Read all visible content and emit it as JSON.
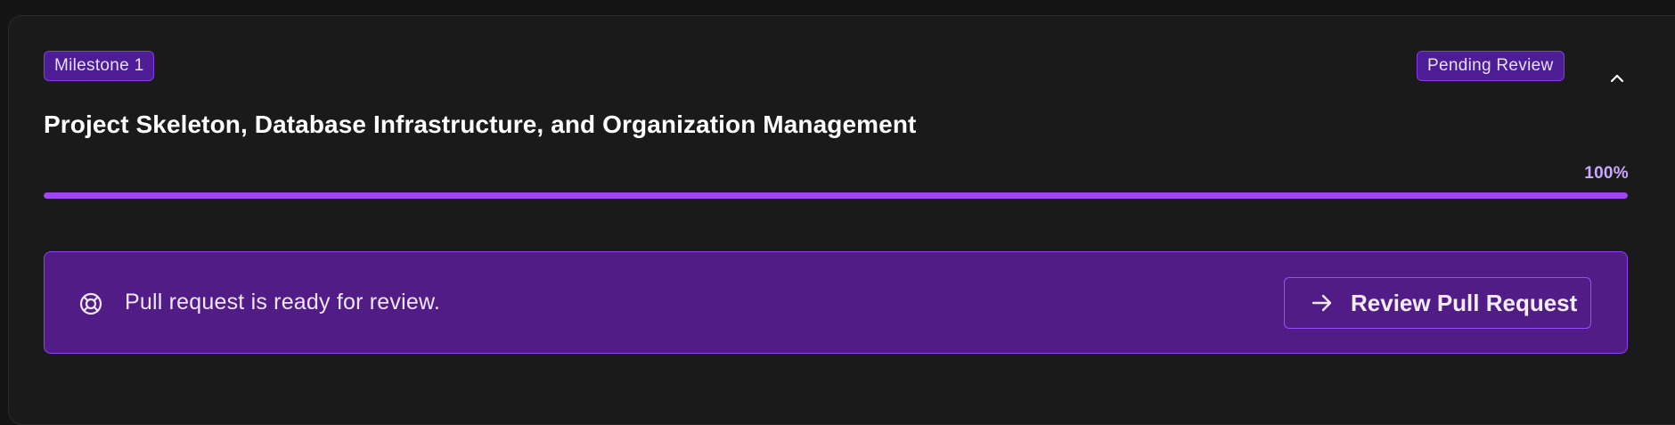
{
  "milestone": {
    "badge_label": "Milestone 1",
    "status_label": "Pending Review",
    "title": "Project Skeleton, Database Infrastructure, and Organization Management",
    "progress": {
      "value": 100,
      "label": "100%"
    }
  },
  "notice": {
    "text": "Pull request is ready for review.",
    "icon": "lifebuoy-icon",
    "button_label": "Review Pull Request",
    "button_icon": "arrow-right-icon"
  },
  "controls": {
    "collapse_icon": "chevron-up-icon"
  },
  "colors": {
    "accent": "#a046f2",
    "badge_bg": "#4c1d95",
    "notice_bg": "#521c87",
    "card_bg": "#1a1a1b"
  }
}
